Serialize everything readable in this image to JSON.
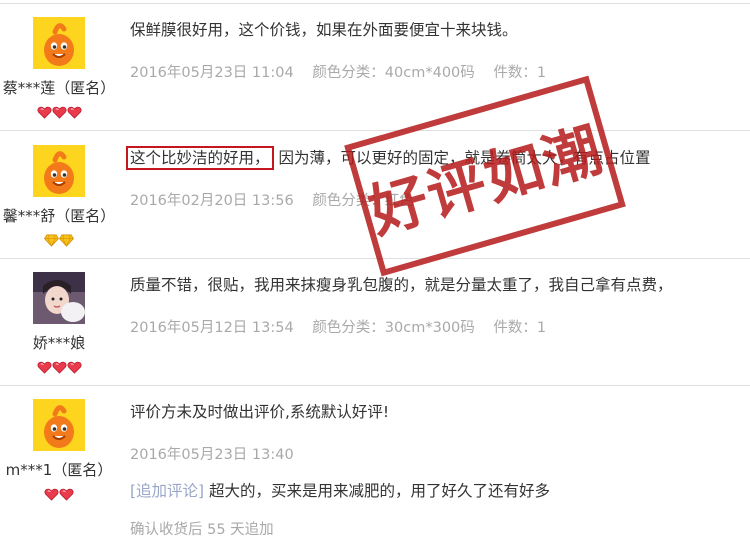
{
  "reviews": [
    {
      "username": "蔡***莲（匿名）",
      "avatar": "taobao-default-avatar",
      "badge_icon": "red-heart-icon",
      "badge_count": 3,
      "text": "保鲜膜很好用，这个价钱，如果在外面要便宜十来块钱。",
      "date": "2016年05月23日 11:04",
      "color_label": "颜色分类：40cm*400码",
      "qty_label": "件数：1"
    },
    {
      "username": "馨***舒（匿名）",
      "avatar": "taobao-default-avatar",
      "badge_icon": "yellow-diamond-icon",
      "badge_count": 2,
      "text_highlight": "这个比妙洁的好用，",
      "text_rest": "因为薄，可以更好的固定，就是卷筒太大，有点占位置",
      "date": "2016年02月20日 13:56",
      "color_label": "颜色分类：红色"
    },
    {
      "username": "娇***娘",
      "avatar": "user-photo-avatar",
      "badge_icon": "red-heart-icon",
      "badge_count": 3,
      "text": "质量不错，很贴，我用来抹瘦身乳包腹的，就是分量太重了，我自己拿有点费，",
      "date": "2016年05月12日 13:54",
      "color_label": "颜色分类：30cm*300码",
      "qty_label": "件数：1"
    },
    {
      "username": "m***1（匿名）",
      "avatar": "taobao-default-avatar",
      "badge_icon": "red-heart-icon",
      "badge_count": 2,
      "text": "评价方未及时做出评价,系统默认好评!",
      "date": "2016年05月23日 13:40",
      "append_label": "[追加评论]",
      "append_text": "超大的，买来是用来减肥的，用了好久了还有好多",
      "append_meta": "确认收货后 55 天追加"
    }
  ],
  "stamp": {
    "text": "好评如潮",
    "color": "#b61b1b"
  },
  "colors": {
    "highlight_box": "#c5161e",
    "meta": "#a9a9a9",
    "append_label": "#9aa6c7"
  }
}
